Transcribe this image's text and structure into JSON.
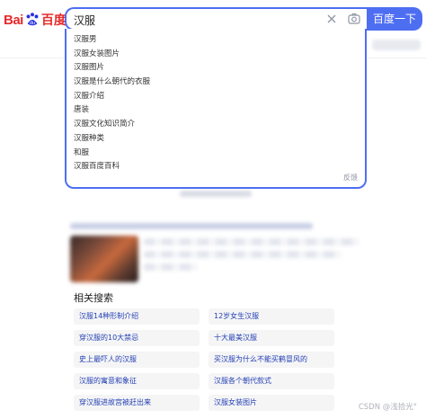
{
  "logo": {
    "left": "Bai",
    "right": "百度"
  },
  "search": {
    "value": "汉服",
    "button_label": "百度一下"
  },
  "suggestions": [
    "汉服男",
    "汉服女装图片",
    "汉服图片",
    "汉服是什么朝代的衣服",
    "汉服介绍",
    "唐装",
    "汉服文化知识简介",
    "汉服种类",
    "和服",
    "汉服百度百科"
  ],
  "feedback_label": "反馈",
  "related": {
    "title": "相关搜索",
    "items": [
      "汉服14种形制介绍",
      "12岁女生汉服",
      "穿汉服的10大禁忌",
      "十大最美汉服",
      "史上最吓人的汉服",
      "买汉服为什么不能买鹤冒风的",
      "汉服的寓意和象征",
      "汉服各个朝代款式",
      "穿汉服进故宫被赶出来",
      "汉服女装图片"
    ]
  },
  "watermark": "CSDN @浅拾光°",
  "colors": {
    "brand_blue": "#4e6ef2",
    "brand_red": "#e62a2a",
    "link_blue": "#2440b3"
  }
}
